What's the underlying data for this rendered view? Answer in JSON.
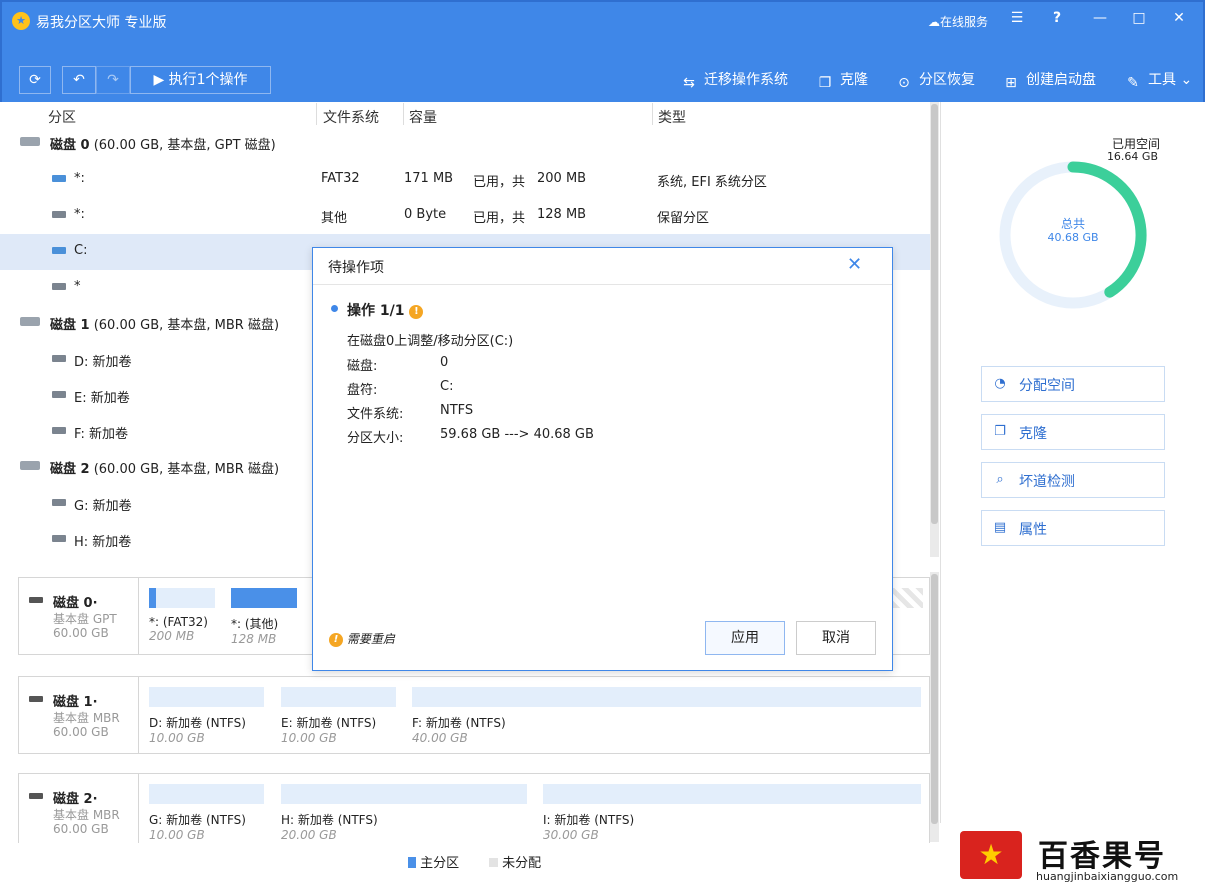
{
  "app": {
    "title": "易我分区大师 专业版",
    "online_service": "在线服务"
  },
  "window_controls": {
    "menu": "☰",
    "help": "?",
    "minimize": "—",
    "maximize": "□",
    "close": "✕"
  },
  "toolbar": {
    "refresh": "⟳",
    "undo": "↶",
    "redo": "↷",
    "execute_label": "▶ 执行1个操作",
    "migrate_os": "迁移操作系统",
    "clone": "克隆",
    "recover": "分区恢复",
    "create_boot": "创建启动盘",
    "tools": "工具"
  },
  "columns": {
    "partition": "分区",
    "filesystem": "文件系统",
    "capacity": "容量",
    "type": "类型"
  },
  "tree": [
    {
      "kind": "disk",
      "name": "磁盘 0",
      "info": "(60.00 GB, 基本盘, GPT 磁盘)"
    },
    {
      "kind": "part",
      "sys": true,
      "name": "*:",
      "fs": "FAT32",
      "used": "171 MB",
      "of": "已用，共",
      "total": "200 MB",
      "type": "系统, EFI 系统分区"
    },
    {
      "kind": "part",
      "sys": false,
      "name": "*:",
      "fs": "其他",
      "used": "0 Byte",
      "of": "已用，共",
      "total": "128 MB",
      "type": "保留分区"
    },
    {
      "kind": "part",
      "sys": true,
      "selected": true,
      "name": "C:",
      "fs": "",
      "used": "",
      "of": "",
      "total": "",
      "type": ""
    },
    {
      "kind": "part",
      "sys": false,
      "name": "*",
      "fs": "",
      "used": "",
      "of": "",
      "total": "",
      "type": ""
    },
    {
      "kind": "disk",
      "name": "磁盘 1",
      "info": "(60.00 GB, 基本盘, MBR 磁盘)"
    },
    {
      "kind": "part",
      "sys": false,
      "name": "D: 新加卷",
      "fs": "",
      "used": "",
      "of": "",
      "total": "",
      "type": ""
    },
    {
      "kind": "part",
      "sys": false,
      "name": "E: 新加卷",
      "fs": "",
      "used": "",
      "of": "",
      "total": "",
      "type": ""
    },
    {
      "kind": "part",
      "sys": false,
      "name": "F: 新加卷",
      "fs": "",
      "used": "",
      "of": "",
      "total": "",
      "type": ""
    },
    {
      "kind": "disk",
      "name": "磁盘 2",
      "info": "(60.00 GB, 基本盘, MBR 磁盘)"
    },
    {
      "kind": "part",
      "sys": false,
      "name": "G: 新加卷",
      "fs": "",
      "used": "",
      "of": "",
      "total": "",
      "type": ""
    },
    {
      "kind": "part",
      "sys": false,
      "name": "H: 新加卷",
      "fs": "",
      "used": "",
      "of": "",
      "total": "",
      "type": ""
    }
  ],
  "disk_maps": [
    {
      "name": "磁盘 0·",
      "type": "基本盘 GPT",
      "size": "60.00 GB",
      "segments": [
        {
          "name": "*:  (FAT32)",
          "size": "200 MB",
          "used": 0.1
        },
        {
          "name": "*:  (其他)",
          "size": "128 MB",
          "used": 1.0
        }
      ]
    },
    {
      "name": "磁盘 1·",
      "type": "基本盘 MBR",
      "size": "60.00 GB",
      "segments": [
        {
          "name": "D: 新加卷 (NTFS)",
          "size": "10.00 GB",
          "used": 0.0
        },
        {
          "name": "E: 新加卷 (NTFS)",
          "size": "10.00 GB",
          "used": 0.0
        },
        {
          "name": "F: 新加卷 (NTFS)",
          "size": "40.00 GB",
          "used": 0.0
        }
      ]
    },
    {
      "name": "磁盘 2·",
      "type": "基本盘 MBR",
      "size": "60.00 GB",
      "segments": [
        {
          "name": "G: 新加卷 (NTFS)",
          "size": "10.00 GB",
          "used": 0.0
        },
        {
          "name": "H: 新加卷 (NTFS)",
          "size": "20.00 GB",
          "used": 0.0
        },
        {
          "name": "I: 新加卷 (NTFS)",
          "size": "30.00 GB",
          "used": 0.0
        }
      ]
    }
  ],
  "legend": {
    "primary": "主分区",
    "unallocated": "未分配"
  },
  "usage": {
    "used_label": "已用空间",
    "used_value": "16.64 GB",
    "total_label": "总共",
    "total_value": "40.68 GB",
    "used_fraction": 0.409,
    "used_color": "#3ccf9a",
    "track_color": "#e8f1fb"
  },
  "side_actions": {
    "allocate": "分配空间",
    "clone": "克隆",
    "bad_sector": "坏道检测",
    "properties": "属性"
  },
  "dialog": {
    "title": "待操作项",
    "close": "✕",
    "op_title": "操作 1/1",
    "op_desc": "在磁盘0上调整/移动分区(C:)",
    "details": [
      {
        "k": "磁盘:",
        "v": "0"
      },
      {
        "k": "盘符:",
        "v": "C:"
      },
      {
        "k": "文件系统:",
        "v": "NTFS"
      },
      {
        "k": "分区大小:",
        "v": "59.68 GB ---> 40.68 GB"
      }
    ],
    "restart": "需要重启",
    "apply": "应用",
    "cancel": "取消"
  },
  "watermark": {
    "text": "百香果号",
    "url": "huangjinbaixiangguo.com"
  }
}
